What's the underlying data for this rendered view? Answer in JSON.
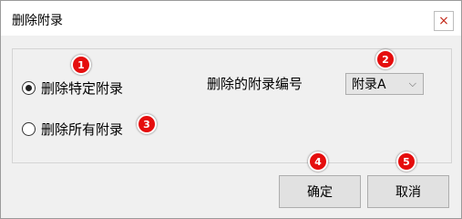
{
  "window": {
    "title": "删除附录",
    "close_icon": "close-icon",
    "close_glyph": "×"
  },
  "options": {
    "delete_specific": "删除特定附录",
    "delete_all": "删除所有附录",
    "selected": "delete_specific"
  },
  "appendix": {
    "label": "删除的附录编号",
    "value": "附录A",
    "chevron": "⌵"
  },
  "buttons": {
    "ok": "确定",
    "cancel": "取消"
  },
  "badges": [
    "1",
    "2",
    "3",
    "4",
    "5"
  ],
  "colors": {
    "badge": "#e50d0d",
    "close": "#c42b1c"
  }
}
